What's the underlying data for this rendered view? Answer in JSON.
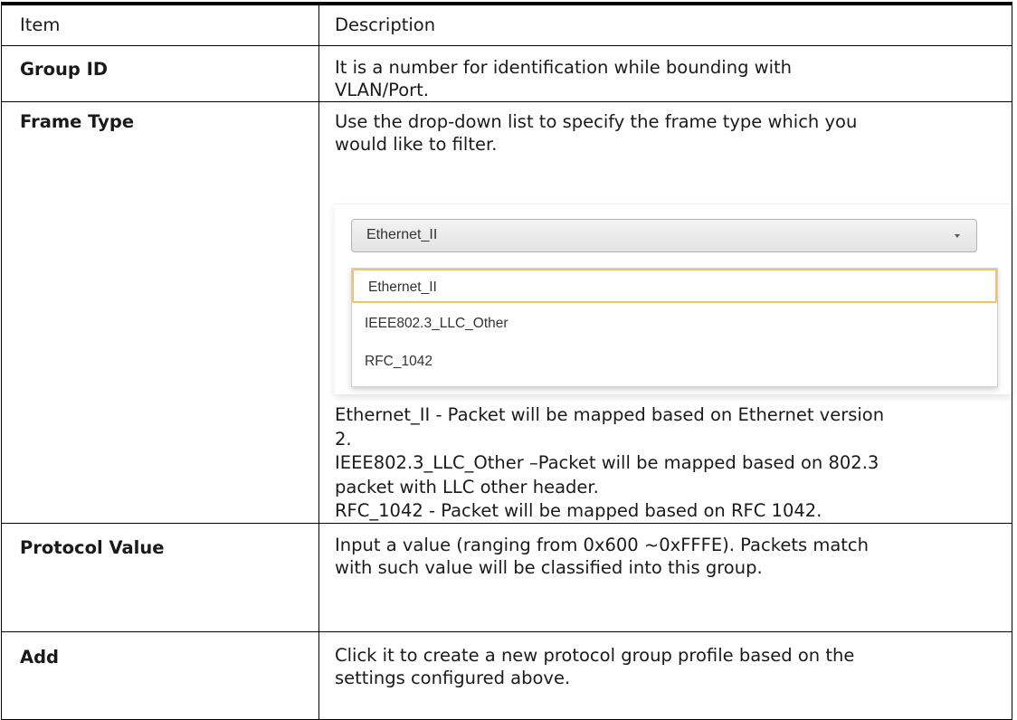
{
  "header": {
    "item": "Item",
    "description": "Description"
  },
  "rows": [
    {
      "item": "Group ID",
      "description": [
        "It is a number for identification while bounding with",
        "VLAN/Port."
      ]
    },
    {
      "item": "Frame Type",
      "description": [
        "Use the drop-down list to specify the frame type which you",
        "would like to filter."
      ],
      "notes": [
        "Ethernet_II - Packet will be mapped based on Ethernet version",
        "2.",
        "IEEE802.3_LLC_Other –Packet will be mapped based on 802.3",
        "packet with LLC other header.",
        "RFC_1042 - Packet will be mapped based on RFC 1042."
      ]
    },
    {
      "item": "Protocol Value",
      "description": [
        "Input a value (ranging from 0x600 ~0xFFFE). Packets match",
        "with such value will be classified into this group."
      ]
    },
    {
      "item": "Add",
      "description": [
        "Click it to create a new protocol group profile based on the",
        "settings configured above."
      ]
    }
  ],
  "dropdown": {
    "selected": "Ethernet_II",
    "options": [
      "Ethernet_II",
      "IEEE802.3_LLC_Other",
      "RFC_1042"
    ],
    "icon": "chevron-down-icon"
  }
}
